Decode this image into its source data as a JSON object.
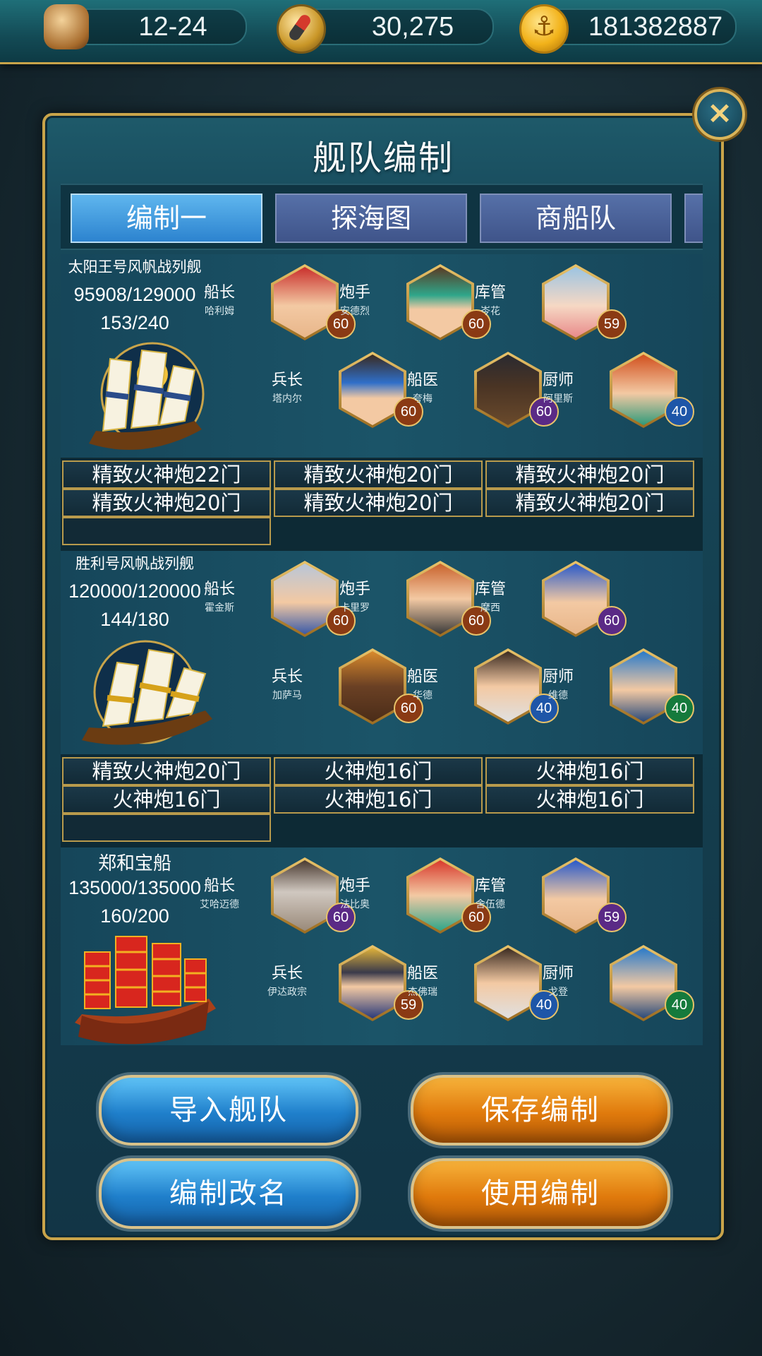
{
  "topbar": {
    "date": "12-24",
    "gems": "30,275",
    "gold": "181382887"
  },
  "panel": {
    "title": "舰队编制",
    "close_icon": "×"
  },
  "tabs": [
    "编制一",
    "探海图",
    "商船队"
  ],
  "ships": [
    {
      "name": "太阳王号风帆战列舰",
      "hp": "95908/129000",
      "crew": "153/240",
      "heroes": [
        {
          "role": "船长",
          "name": "哈利姆",
          "level": "60",
          "level_color": "brown"
        },
        {
          "role": "炮手",
          "name": "安德烈",
          "level": "60",
          "level_color": "brown"
        },
        {
          "role": "库管",
          "name": "岑花",
          "level": "59",
          "level_color": "brown"
        },
        {
          "role": "兵长",
          "name": "塔内尔",
          "level": "60",
          "level_color": "brown"
        },
        {
          "role": "船医",
          "name": "夸梅",
          "level": "60",
          "level_color": "purple"
        },
        {
          "role": "厨师",
          "name": "阿里斯",
          "level": "40",
          "level_color": "blue"
        }
      ],
      "cannons": [
        "精致火神炮22门",
        "精致火神炮20门",
        "精致火神炮20门",
        "精致火神炮20门",
        "精致火神炮20门",
        "精致火神炮20门"
      ]
    },
    {
      "name": "胜利号风帆战列舰",
      "hp": "120000/120000",
      "crew": "144/180",
      "heroes": [
        {
          "role": "船长",
          "name": "霍金斯",
          "level": "60",
          "level_color": "brown"
        },
        {
          "role": "炮手",
          "name": "卡里罗",
          "level": "60",
          "level_color": "brown"
        },
        {
          "role": "库管",
          "name": "摩西",
          "level": "60",
          "level_color": "purple"
        },
        {
          "role": "兵长",
          "name": "加萨马",
          "level": "60",
          "level_color": "brown"
        },
        {
          "role": "船医",
          "name": "华德",
          "level": "40",
          "level_color": "blue"
        },
        {
          "role": "厨师",
          "name": "维德",
          "level": "40",
          "level_color": "green"
        }
      ],
      "cannons": [
        "精致火神炮20门",
        "火神炮16门",
        "火神炮16门",
        "火神炮16门",
        "火神炮16门",
        "火神炮16门"
      ]
    },
    {
      "name": "郑和宝船",
      "hp": "135000/135000",
      "crew": "160/200",
      "heroes": [
        {
          "role": "船长",
          "name": "艾哈迈德",
          "level": "60",
          "level_color": "purple"
        },
        {
          "role": "炮手",
          "name": "法比奥",
          "level": "60",
          "level_color": "brown"
        },
        {
          "role": "库管",
          "name": "舍伍德",
          "level": "59",
          "level_color": "purple"
        },
        {
          "role": "兵长",
          "name": "伊达政宗",
          "level": "59",
          "level_color": "brown"
        },
        {
          "role": "船医",
          "name": "杰佛瑞",
          "level": "40",
          "level_color": "blue"
        },
        {
          "role": "厨师",
          "name": "戈登",
          "level": "40",
          "level_color": "green"
        }
      ],
      "cannons": []
    }
  ],
  "buttons": {
    "import": "导入舰队",
    "save": "保存编制",
    "rename": "编制改名",
    "use": "使用编制"
  }
}
